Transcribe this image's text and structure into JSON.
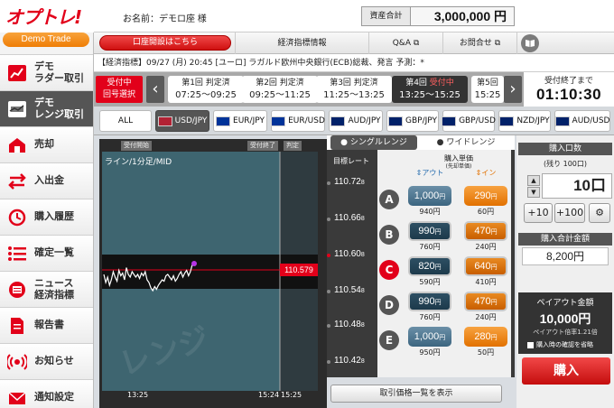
{
  "logo": "オプトレ!",
  "demo_badge": "Demo Trade",
  "sidebar": [
    {
      "label": "デモ\nラダー取引",
      "icon": "ladder-chart-icon"
    },
    {
      "label": "デモ\nレンジ取引",
      "icon": "range-chart-icon"
    },
    {
      "label": "売却",
      "icon": "sell-icon"
    },
    {
      "label": "入出金",
      "icon": "transfer-icon"
    },
    {
      "label": "購入履歴",
      "icon": "history-icon"
    },
    {
      "label": "確定一覧",
      "icon": "list-icon"
    },
    {
      "label": "ニュース\n経済指標",
      "icon": "news-icon"
    },
    {
      "label": "報告書",
      "icon": "report-icon"
    },
    {
      "label": "お知らせ",
      "icon": "broadcast-icon"
    },
    {
      "label": "通知設定",
      "icon": "mail-icon"
    }
  ],
  "header": {
    "account": "お名前：デモロ座 様",
    "asset_label": "資産合計",
    "asset_value": "3,000,000 円"
  },
  "nav": {
    "open_account": "口座開設はこちら",
    "economic": "経済指標情報",
    "qa": "Q&A ⧉",
    "contact": "お問合せ ⧉"
  },
  "ticker": "【経済指標】09/27 (月) 20:45 [ユーロ] ラガルド欧州中央銀行(ECB)総裁、発言 予測：*",
  "rounds": {
    "status": "受付中\n回号選択",
    "cards": [
      {
        "title": "第1回 判定済",
        "time": "07:25〜09:25"
      },
      {
        "title": "第2回 判定済",
        "time": "09:25〜11:25"
      },
      {
        "title": "第3回 判定済",
        "time": "11:25〜13:25"
      },
      {
        "title": "第4回",
        "live": "受付中",
        "time": "13:25〜15:25"
      },
      {
        "title": "第5回",
        "time": "15:25"
      }
    ],
    "countdown_label": "受付終了まで",
    "countdown": "01:10:30"
  },
  "currency_tabs": [
    "ALL",
    "USD/JPY",
    "EUR/JPY",
    "EUR/USD",
    "AUD/JPY",
    "GBP/JPY",
    "GBP/USD",
    "NZD/JPY",
    "AUD/USD"
  ],
  "chart": {
    "hdr_start": "受付開始",
    "hdr_end": "受付終了",
    "hdr_judge": "判定",
    "title": "ライン/1分足/MID",
    "current_price": "110.579",
    "watermark": "レンジ",
    "x_start": "13:25",
    "x_mid": "15:24",
    "x_end": "15:25",
    "series": [
      0.6,
      0.3,
      0.5,
      0.2,
      0.4,
      0.7,
      0.5,
      0.35,
      0.75,
      0.55,
      0.65,
      0.4,
      0.85,
      0.6,
      0.5,
      0.7,
      0.6,
      0.5,
      0.6,
      0.45,
      0.65,
      0.55,
      0.7,
      0.4,
      0.3,
      0.1,
      0.0,
      0.15,
      0.05,
      0.2,
      0.3,
      0.4,
      0.35,
      0.55,
      0.6,
      0.5,
      0.4,
      0.55,
      0.35,
      0.45,
      0.6,
      0.7,
      0.5,
      0.65,
      0.75,
      0.55,
      0.7,
      0.95,
      1.0
    ]
  },
  "order": {
    "tab_single": "● シングルレンジ",
    "tab_wide": "● ワイドレンジ",
    "target_rate_label": "目標レート",
    "unit_price_label": "購入単価",
    "unit_price_sub": "(先却単価)",
    "out_label": "⇕アウト",
    "in_label": "⇕イン",
    "rates": [
      "110.72",
      "110.66",
      "110.60",
      "110.54",
      "110.48",
      "110.42"
    ],
    "rate_suffix": "8",
    "rows": [
      {
        "letter": "A",
        "out": "1,000",
        "out_sub": "940円",
        "in": "290",
        "in_sub": "60円"
      },
      {
        "letter": "B",
        "out": "990",
        "out_sub": "760円",
        "in": "470",
        "in_sub": "240円"
      },
      {
        "letter": "C",
        "out": "820",
        "out_sub": "590円",
        "in": "640",
        "in_sub": "410円"
      },
      {
        "letter": "D",
        "out": "990",
        "out_sub": "760円",
        "in": "470",
        "in_sub": "240円"
      },
      {
        "letter": "E",
        "out": "1,000",
        "out_sub": "950円",
        "in": "280",
        "in_sub": "50円"
      }
    ],
    "yen": "円",
    "list_button": "取引価格一覧を表示"
  },
  "buy": {
    "qty_label": "購入口数",
    "qty_remaining": "(残り 100口)",
    "qty_value": "10口",
    "plus10": "+10",
    "plus100": "+100",
    "total_label": "購入合計金額",
    "total_value": "8,200円",
    "payout_label": "ペイアウト金額",
    "payout_value": "10,000円",
    "payout_ratio": "ペイアウト倍率1.21倍",
    "omit_confirm": "購入時の確認を省略",
    "buy_button": "購入"
  }
}
